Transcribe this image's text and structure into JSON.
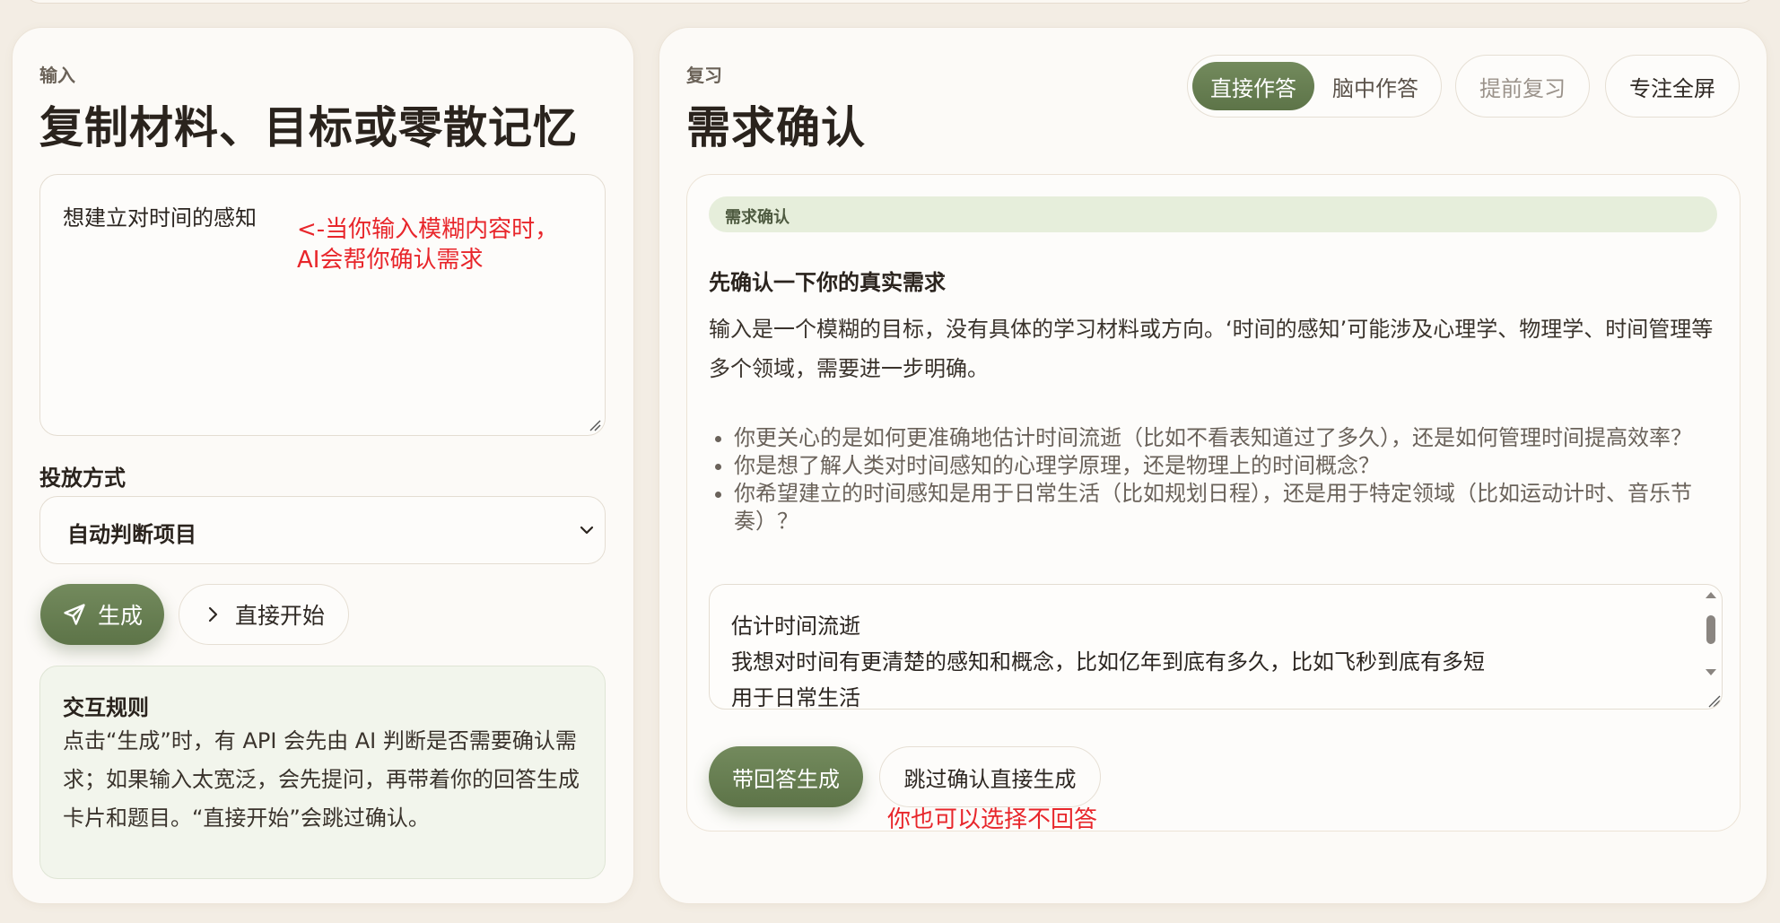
{
  "input_panel": {
    "eyebrow": "输入",
    "title": "复制材料、目标或零散记忆",
    "textarea_value": "想建立对时间的感知",
    "annotation_lines": [
      "<-当你输入模糊内容时，",
      "AI会帮你确认需求"
    ],
    "delivery_label": "投放方式",
    "delivery_selected": "自动判断项目",
    "generate_label": "生成",
    "start_label": "直接开始",
    "rules_title": "交互规则",
    "rules_text": "点击“生成”时，有 API 会先由 AI 判断是否需要确认需求；如果输入太宽泛，会先提问，再带着你的回答生成卡片和题目。“直接开始”会跳过确认。"
  },
  "review_panel": {
    "eyebrow": "复习",
    "title": "需求确认",
    "mode_tabs": [
      "直接作答",
      "脑中作答"
    ],
    "early_review_label": "提前复习",
    "fullscreen_label": "专注全屏",
    "card": {
      "tag": "需求确认",
      "heading": "先确认一下你的真实需求",
      "paragraph": "输入是一个模糊的目标，没有具体的学习材料或方向。‘时间的感知’可能涉及心理学、物理学、时间管理等多个领域，需要进一步明确。",
      "questions": [
        "你更关心的是如何更准确地估计时间流逝（比如不看表知道过了多久），还是如何管理时间提高效率？",
        "你是想了解人类对时间感知的心理学原理，还是物理上的时间概念？",
        "你希望建立的时间感知是用于日常生活（比如规划日程），还是用于特定领域（比如运动计时、音乐节奏）？"
      ],
      "answer_lines": [
        "估计时间流逝",
        "我想对时间有更清楚的感知和概念，比如亿年到底有多久，比如飞秒到底有多短",
        "用于日常生活"
      ],
      "answer_button": "带回答生成",
      "skip_button": "跳过确认直接生成",
      "skip_annotation": "你也可以选择不回答"
    }
  },
  "colors": {
    "accent": "#66804f",
    "background": "#f3ede4",
    "annotation": "#e8262b",
    "tag_background": "#e6eedb"
  },
  "icons": [
    "send-icon",
    "chevron-right-icon",
    "chevron-down-icon",
    "resize-grip-icon"
  ]
}
